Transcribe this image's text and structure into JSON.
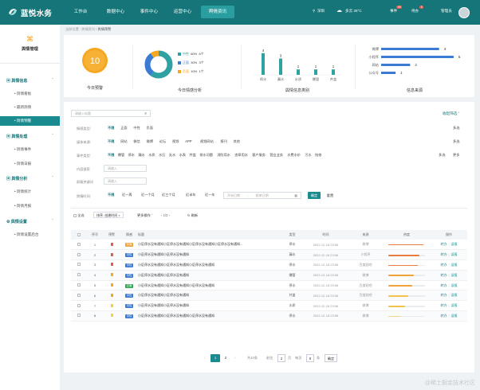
{
  "app": {
    "name": "蓝悦水务"
  },
  "topnav": [
    {
      "label": "工作台"
    },
    {
      "label": "数据中心"
    },
    {
      "label": "事件中心"
    },
    {
      "label": "运营中心"
    },
    {
      "label": "舆情资讯",
      "active": true
    }
  ],
  "topbar": {
    "location": "深圳",
    "weather": "多云 28°C",
    "events_label": "事件",
    "events_count": "99",
    "todo_label": "待办",
    "todo_count": "5",
    "user": "管理员"
  },
  "sidebar": {
    "title": "舆情管理",
    "groups": [
      {
        "label": "舆情信息",
        "items": [
          "舆情看板",
          "最新舆情",
          "舆情预警"
        ]
      },
      {
        "label": "舆情处理",
        "items": [
          "舆情事件",
          "舆情日报"
        ]
      },
      {
        "label": "舆情分析",
        "items": [
          "舆情统计",
          "舆情月报"
        ]
      },
      {
        "label": "舆情设置",
        "items": [
          "舆情设置后台"
        ]
      }
    ],
    "active_item": "舆情预警"
  },
  "breadcrumb": [
    "当前位置",
    "舆情资讯",
    "舆情预警"
  ],
  "stats": {
    "today_warning": {
      "value": "10",
      "label": "今日预警"
    },
    "sentiment": {
      "label": "今日情感分析",
      "items": [
        {
          "name": "中性",
          "pct": "60%",
          "count": "6个",
          "value": 60,
          "color": "#2fa1a3"
        },
        {
          "name": "正面",
          "pct": "30%",
          "count": "3个",
          "value": 30,
          "color": "#3b7bd4"
        },
        {
          "name": "负面",
          "pct": "10%",
          "count": "1个",
          "value": 10,
          "color": "#f5a623"
        }
      ]
    },
    "types": {
      "label": "舆情信息类别",
      "categories": [
        "停水",
        "漏水",
        "水质",
        "爆管",
        "井盖"
      ],
      "values": [
        4,
        3,
        1,
        1,
        1
      ]
    },
    "sources": {
      "label": "信息来源",
      "categories": [
        "微博",
        "小程序",
        "网站",
        "公众号"
      ],
      "values": [
        4,
        5,
        2,
        1
      ]
    }
  },
  "chart_data": [
    {
      "type": "bar",
      "title": "舆情信息类别",
      "categories": [
        "停水",
        "漏水",
        "水质",
        "爆管",
        "井盖"
      ],
      "values": [
        4,
        3,
        1,
        1,
        1
      ]
    },
    {
      "type": "bar",
      "title": "信息来源",
      "orientation": "horizontal",
      "categories": [
        "微博",
        "小程序",
        "网站",
        "公众号"
      ],
      "values": [
        4,
        5,
        2,
        1
      ]
    },
    {
      "type": "pie",
      "title": "今日情感分析",
      "categories": [
        "中性",
        "正面",
        "负面"
      ],
      "values": [
        60,
        30,
        10
      ]
    }
  ],
  "filters": {
    "search_placeholder": "请输入标题",
    "collapse_label": "收起筛选",
    "rows": [
      {
        "label": "情感类型:",
        "options": [
          "不限",
          "正面",
          "中性",
          "负面"
        ],
        "extra": [
          "多选"
        ]
      },
      {
        "label": "媒体来源:",
        "options": [
          "不限",
          "网站",
          "微信",
          "微博",
          "论坛",
          "视频",
          "APP",
          "视频网站",
          "报刊",
          "其他"
        ],
        "extra": [
          "多选"
        ]
      },
      {
        "label": "事件类型:",
        "options": [
          "不限",
          "爆管",
          "停水",
          "漏水",
          "水质",
          "水压",
          "无水",
          "水表",
          "井盖",
          "排水问题",
          "消防用水",
          "违章用水",
          "客户服务",
          "营业业务",
          "水费水价",
          "污水",
          "抢修"
        ],
        "extra": [
          "多选",
          "更多"
        ]
      }
    ],
    "content_label": "内容搜索",
    "content_placeholder": "请输入",
    "exclude_label": "屏蔽关键词",
    "exclude_placeholder": "请输入",
    "time_label": "舆情时间:",
    "time_options": [
      "不限",
      "近一周",
      "近一个月",
      "近三个月",
      "近半年",
      "近一年"
    ],
    "start_placeholder": "开始日期",
    "end_placeholder": "结束日期",
    "range_sep": "-",
    "confirm_label": "确定",
    "reset_label": "重置"
  },
  "toolbar": {
    "select_all": "全选",
    "sort_label": "排序: 创建时间",
    "more_label": "更多操作",
    "page_info": "1/3",
    "refresh_label": "刷新"
  },
  "table": {
    "headers": [
      "",
      "序号",
      "预警",
      "情感",
      "标题",
      "类型",
      "时间",
      "来源",
      "热度",
      "操作"
    ],
    "actions": [
      "转办",
      "误报"
    ],
    "rows": [
      {
        "no": "1",
        "warn": "#e05a4f",
        "sent": "负面",
        "sentColor": "#f0a23a",
        "title": "小区停水没有通知小区停水没有通知小区停水没有通知小区停水没有通知...",
        "type": "停水",
        "time": "2022-12-18 23:56",
        "source": "微博",
        "heat": 0.95,
        "heatColor": "#e87b3f"
      },
      {
        "no": "2",
        "warn": "#e05a4f",
        "sent": "中性",
        "sentColor": "#3b7bd4",
        "title": "小区停水没有通知小区停水没有通知",
        "type": "漏水",
        "time": "2022-12-18 23:56",
        "source": "小程序",
        "heat": 0.85,
        "heatColor": "#e87b3f"
      },
      {
        "no": "3",
        "warn": "#e05a4f",
        "sent": "中性",
        "sentColor": "#3b7bd4",
        "title": "小区停水没有通知小区停水没有通知小区停水没有通知",
        "type": "停水",
        "time": "2022-12-18 23:56",
        "source": "百度贴吧",
        "heat": 0.8,
        "heatColor": "#e87b3f"
      },
      {
        "no": "4",
        "warn": "#f5a623",
        "sent": "中性",
        "sentColor": "#3b7bd4",
        "title": "小区停水没有通知小区停水没有通知",
        "type": "爆管",
        "time": "2022-12-18 23:56",
        "source": "微博",
        "heat": 0.7,
        "heatColor": "#f0a23a"
      },
      {
        "no": "5",
        "warn": "#f5a623",
        "sent": "正面",
        "sentColor": "#2fa84f",
        "title": "小区停水没有通知小区停水没有通知小区停水没有通知",
        "type": "停水",
        "time": "2022-12-18 23:56",
        "source": "百度贴吧",
        "heat": 0.65,
        "heatColor": "#f0a23a"
      },
      {
        "no": "6",
        "warn": "#f5a623",
        "sent": "中性",
        "sentColor": "#3b7bd4",
        "title": "小区停水没有通知小区停水没有通知",
        "type": "井盖",
        "time": "2022-12-18 23:56",
        "source": "百度贴吧",
        "heat": 0.55,
        "heatColor": "#f3c24a"
      },
      {
        "no": "7",
        "warn": "#f5d043",
        "sent": "中性",
        "sentColor": "#3b7bd4",
        "title": "小区停水没有通知小区停水没有通知",
        "type": "水质",
        "time": "2022-12-18 23:56",
        "source": "微博",
        "heat": 0.45,
        "heatColor": "#f3c24a"
      },
      {
        "no": "8",
        "warn": "#f5d043",
        "sent": "中性",
        "sentColor": "#3b7bd4",
        "title": "小区停水没有通知小区停水没有通知小区停水没有通知",
        "type": "停水",
        "time": "2022-12-18 23:56",
        "source": "微博",
        "heat": 0.35,
        "heatColor": "#f3d68a"
      }
    ]
  },
  "pagination": {
    "prev": "‹",
    "pages": [
      "1",
      "2"
    ],
    "next": "›",
    "total": "共10条",
    "goto": "前往",
    "page_input": "2",
    "page_unit": "页",
    "per_label": "每页",
    "per_value": "8",
    "per_unit": "条",
    "confirm": "确定"
  },
  "watermark": "@稀土掘金技术社区"
}
